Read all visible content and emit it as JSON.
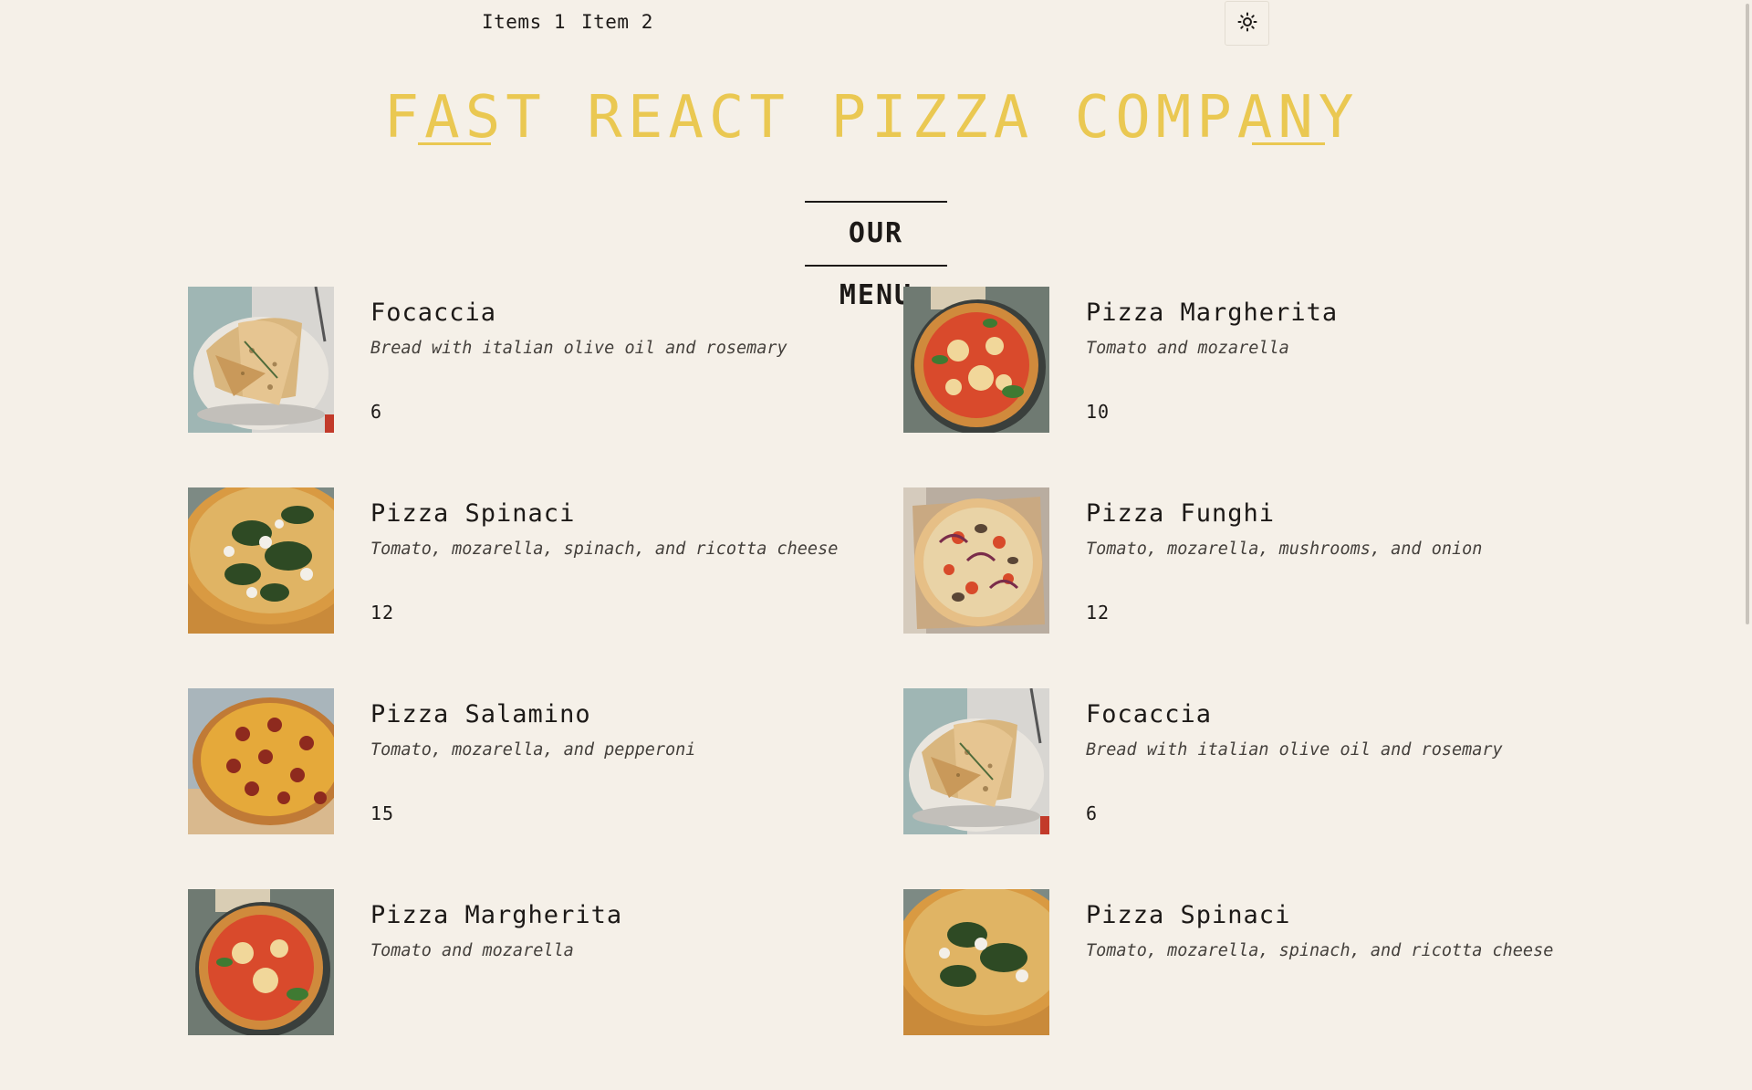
{
  "nav": {
    "items": [
      {
        "label": "Items 1"
      },
      {
        "label": "Item 2"
      }
    ],
    "theme_toggle_icon": "sun-icon"
  },
  "header": {
    "title": "FAST REACT PIZZA COMPANY",
    "accent_color": "#eac852"
  },
  "menu": {
    "section_title": "OUR MENU",
    "items": [
      {
        "name": "Focaccia",
        "description": "Bread with italian olive oil and rosemary",
        "price": "6",
        "image": "focaccia-image"
      },
      {
        "name": "Pizza Margherita",
        "description": "Tomato and mozarella",
        "price": "10",
        "image": "margherita-image"
      },
      {
        "name": "Pizza Spinaci",
        "description": "Tomato, mozarella, spinach, and ricotta cheese",
        "price": "12",
        "image": "spinaci-image"
      },
      {
        "name": "Pizza Funghi",
        "description": "Tomato, mozarella, mushrooms, and onion",
        "price": "12",
        "image": "funghi-image"
      },
      {
        "name": "Pizza Salamino",
        "description": "Tomato, mozarella, and pepperoni",
        "price": "15",
        "image": "salamino-image"
      },
      {
        "name": "Focaccia",
        "description": "Bread with italian olive oil and rosemary",
        "price": "6",
        "image": "focaccia-image"
      },
      {
        "name": "Pizza Margherita",
        "description": "Tomato and mozarella",
        "price": "",
        "image": "margherita-image"
      },
      {
        "name": "Pizza Spinaci",
        "description": "Tomato, mozarella, spinach, and ricotta cheese",
        "price": "",
        "image": "spinaci-image"
      }
    ]
  }
}
